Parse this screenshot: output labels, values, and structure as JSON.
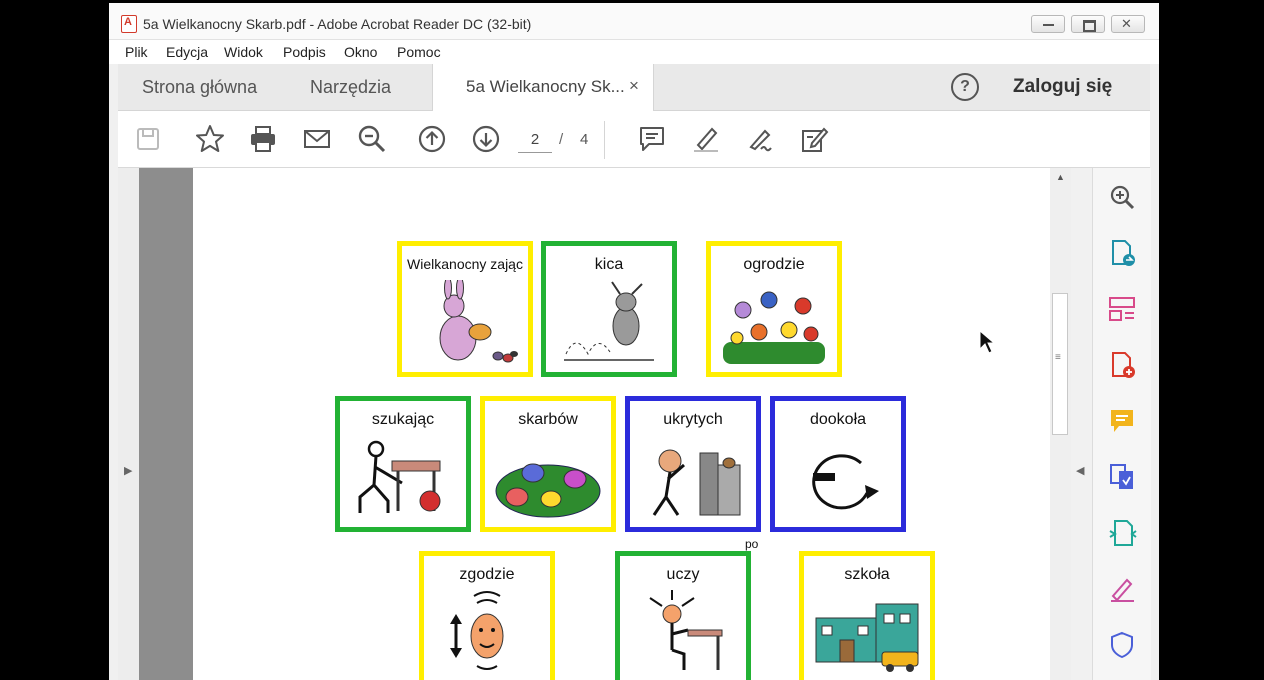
{
  "window": {
    "title": "5a Wielkanocny Skarb.pdf - Adobe Acrobat Reader DC (32-bit)"
  },
  "menu": [
    "Plik",
    "Edycja",
    "Widok",
    "Podpis",
    "Okno",
    "Pomoc"
  ],
  "tabs": {
    "home": "Strona główna",
    "tools": "Narzędzia",
    "document": "5a Wielkanocny Sk...",
    "close_glyph": "×"
  },
  "header": {
    "help_glyph": "?",
    "signin": "Zaloguj się"
  },
  "toolbar": {
    "icons": [
      "save-icon",
      "star-icon",
      "print-icon",
      "mail-icon",
      "zoom-out-icon",
      "page-up-icon",
      "page-down-icon",
      "comment-icon",
      "highlight-icon",
      "sign-icon",
      "edit-form-icon"
    ],
    "page_current": "2",
    "page_separator": "/",
    "page_total": "4"
  },
  "right_pane_icons": [
    "zoom-in-icon",
    "export-pdf-icon",
    "organize-pages-icon",
    "create-pdf-icon",
    "comment-icon",
    "send-for-review-icon",
    "compress-icon",
    "fill-sign-icon",
    "protect-icon"
  ],
  "cards": [
    {
      "label": "Wielkanocny zając",
      "border": "#ffee00"
    },
    {
      "label": "kica",
      "border": "#22b234"
    },
    {
      "label": "ogrodzie",
      "border": "#ffee00"
    },
    {
      "label": "szukając",
      "border": "#22b234"
    },
    {
      "label": "skarbów",
      "border": "#ffee00"
    },
    {
      "label": "ukrytych",
      "border": "#2b2bdb"
    },
    {
      "label": "dookoła",
      "border": "#2b2bdb"
    },
    {
      "label": "zgodzie",
      "border": "#ffee00"
    },
    {
      "label": "uczy",
      "border": "#22b234"
    },
    {
      "label": "szkoła",
      "border": "#ffee00"
    }
  ],
  "page_text_fragments": {
    "po": "po"
  }
}
